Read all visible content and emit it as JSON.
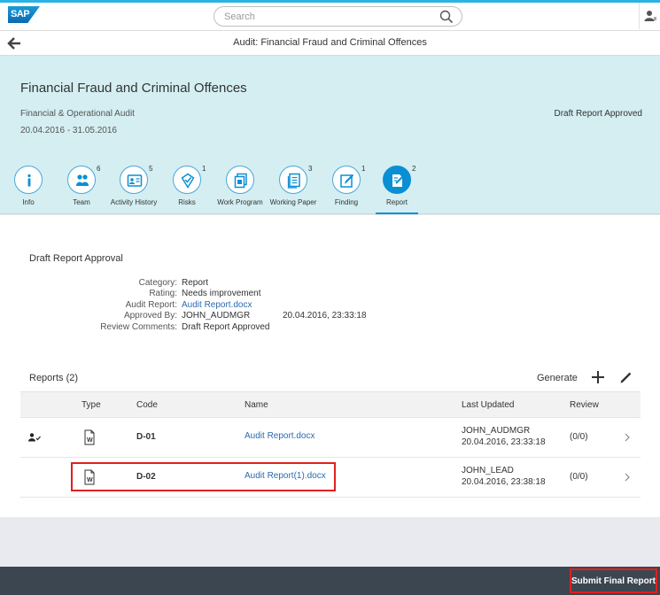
{
  "shell": {
    "logo_text": "SAP",
    "search_placeholder": "Search"
  },
  "nav": {
    "title": "Audit: Financial Fraud and Criminal Offences"
  },
  "header": {
    "title": "Financial Fraud and Criminal Offences",
    "subtitle": "Financial & Operational Audit",
    "dates": "20.04.2016 - 31.05.2016",
    "status": "Draft Report Approved"
  },
  "tabs": [
    {
      "label": "Info",
      "count": "",
      "icon": "info-icon"
    },
    {
      "label": "Team",
      "count": "6",
      "icon": "team-icon"
    },
    {
      "label": "Activity History",
      "count": "5",
      "icon": "activity-history-icon"
    },
    {
      "label": "Risks",
      "count": "1",
      "icon": "risk-icon"
    },
    {
      "label": "Work Program",
      "count": "",
      "icon": "work-program-icon"
    },
    {
      "label": "Working Paper",
      "count": "3",
      "icon": "working-paper-icon"
    },
    {
      "label": "Finding",
      "count": "1",
      "icon": "finding-icon"
    },
    {
      "label": "Report",
      "count": "2",
      "icon": "report-icon",
      "active": true
    }
  ],
  "approval": {
    "title": "Draft Report Approval",
    "category_label": "Category:",
    "category": "Report",
    "rating_label": "Rating:",
    "rating": "Needs improvement",
    "audit_report_label": "Audit Report:",
    "audit_report": "Audit Report.docx",
    "approved_by_label": "Approved By:",
    "approved_by": "JOHN_AUDMGR",
    "approved_on": "20.04.2016, 23:33:18",
    "review_comments_label": "Review Comments:",
    "review_comments": "Draft Report Approved"
  },
  "reports": {
    "title": "Reports (2)",
    "generate_label": "Generate",
    "columns": [
      "Type",
      "Code",
      "Name",
      "Last Updated",
      "Review"
    ],
    "rows": [
      {
        "code": "D-01",
        "name": "Audit Report.docx",
        "updated_by": "JOHN_AUDMGR",
        "updated_on": "20.04.2016, 23:33:18",
        "review": "(0/0)",
        "approved_icon": true
      },
      {
        "code": "D-02",
        "name": "Audit Report(1).docx",
        "updated_by": "JOHN_LEAD",
        "updated_on": "20.04.2016, 23:38:18",
        "review": "(0/0)",
        "approved_icon": false
      }
    ]
  },
  "footer": {
    "submit_label": "Submit Final Report"
  },
  "colors": {
    "accent": "#0a8fd5",
    "header_bg": "#d4eef2",
    "footer_bg": "#3c4650",
    "highlight": "#e0201f",
    "link": "#2a6bb0"
  }
}
